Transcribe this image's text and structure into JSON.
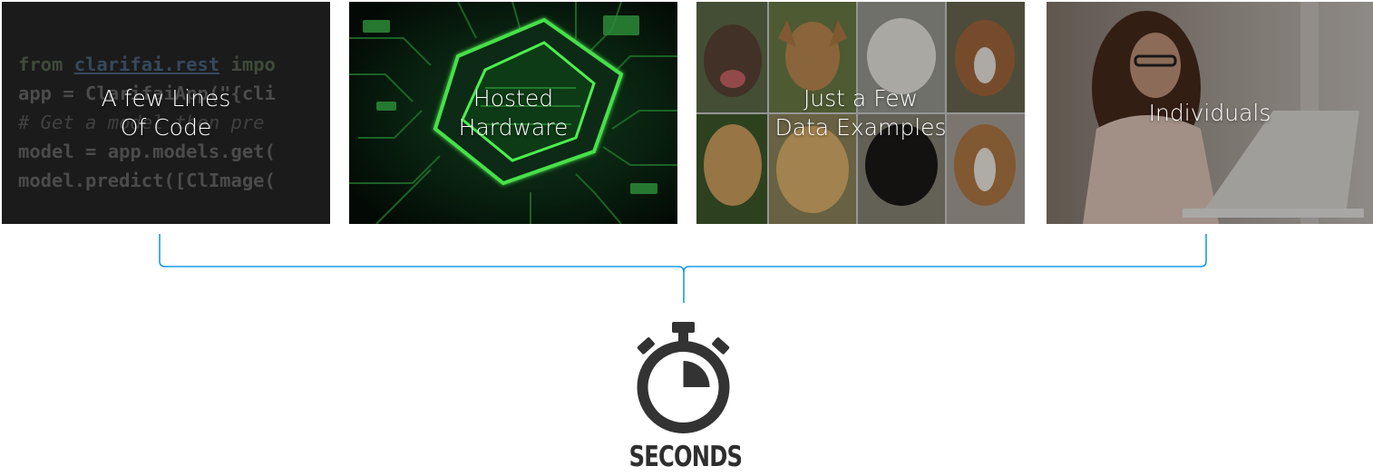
{
  "cards": [
    {
      "caption_lines": [
        "A few Lines",
        "Of Code"
      ],
      "image": "python-code-snippet"
    },
    {
      "caption_lines": [
        "Hosted",
        "Hardware"
      ],
      "image": "glowing-green-circuit-chip"
    },
    {
      "caption_lines": [
        "Just a Few",
        "Data Examples"
      ],
      "image": "grid-of-dog-photos"
    },
    {
      "caption_lines": [
        "Individuals"
      ],
      "image": "woman-using-laptop"
    }
  ],
  "code_snippet": {
    "line1_kw": "from",
    "line1_module": "clarifai.rest",
    "line1_rest": "impo",
    "line2": "app = ClarifaiApp(\"{cli",
    "line3": "# Get a model then pre",
    "line4": "model = app.models.get(",
    "line5": "model.predict([ClImage("
  },
  "timer": {
    "icon": "stopwatch-icon",
    "label": "SECONDS"
  },
  "colors": {
    "bracket": "#1a9be6",
    "stopwatch": "#333333",
    "chip_glow": "#39e03a"
  }
}
